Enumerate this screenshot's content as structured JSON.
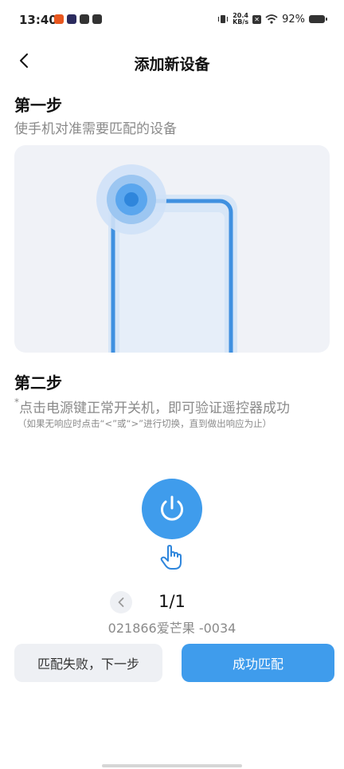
{
  "status_bar": {
    "time": "13:40",
    "net_speed_value": "20.4",
    "net_speed_unit": "KB/s",
    "battery_percent": "92%",
    "app_icons": [
      "orange-app-icon",
      "play-app-icon",
      "link-app-icon",
      "message-app-icon"
    ],
    "app_icon_colors": [
      "#e8571f",
      "#2b2b5e",
      "#333333",
      "#333333"
    ]
  },
  "header": {
    "title": "添加新设备"
  },
  "step1": {
    "title": "第一步",
    "subtitle": "使手机对准需要匹配的设备"
  },
  "step2": {
    "title": "第二步",
    "asterisk": "*",
    "instruction": "点击电源键正常开关机，即可验证遥控器成功",
    "note": "（如果无响应时点击“<”或“>”进行切换，直到做出响应为止）"
  },
  "pager": {
    "count": "1/1"
  },
  "device_name": "021866爱芒果 -0034",
  "buttons": {
    "fail_label": "匹配失败，下一步",
    "success_label": "成功匹配"
  },
  "colors": {
    "accent": "#3f9cec",
    "muted_text": "#8a8a8a",
    "illustration_bg": "#f0f2f7"
  }
}
